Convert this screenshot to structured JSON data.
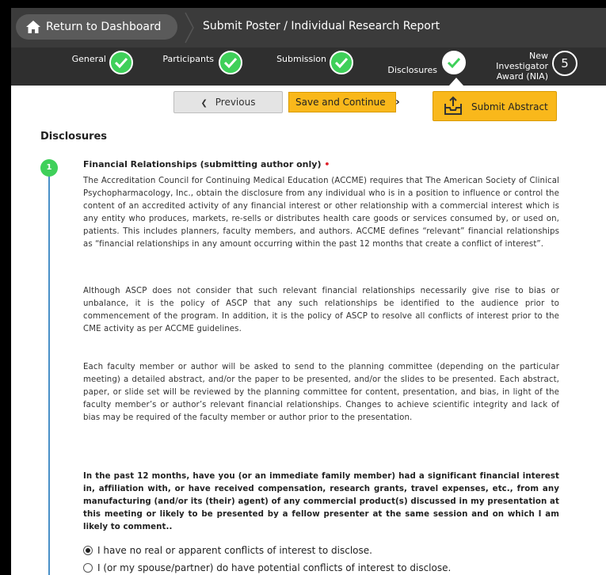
{
  "header": {
    "dashboard_label": "Return to Dashboard",
    "page_title": "Submit Poster / Individual Research Report"
  },
  "steps": {
    "general": "General",
    "participants": "Participants",
    "submission": "Submission",
    "disclosures": "Disclosures",
    "nia_line1": "New",
    "nia_line2": "Investigator",
    "nia_line3": "Award (NIA)",
    "nia_number": "5"
  },
  "actions": {
    "previous": "Previous",
    "save_continue": "Save and Continue",
    "submit": "Submit Abstract"
  },
  "section": {
    "title": "Disclosures",
    "step_number": "1",
    "question_title": "Financial Relationships (submitting author only)",
    "required_mark": "•",
    "para1": "The Accreditation Council for Continuing Medical Education (ACCME) requires that The American Society of Clinical Psychopharmacology, Inc., obtain the disclosure from any individual who is in a position to influence or control the content of an accredited activity of any financial interest or other relationship with a commercial interest which is any entity who produces, markets, re-sells or distributes health care goods or services consumed by, or used on, patients. This includes planners, faculty members, and authors. ACCME defines “relevant” financial relationships as “financial relationships in any amount occurring within the past 12 months that create a conflict of interest”.",
    "para2": "Although ASCP does not consider that such relevant financial relationships necessarily give rise to bias or unbalance, it is the policy of ASCP that any such relationships be identified to the audience prior to commencement of the program. In addition, it is the policy of ASCP to resolve all conflicts of interest prior to the CME activity as per ACCME guidelines.",
    "para3": "Each faculty member or author will be asked to send to the planning committee (depending on the particular meeting) a detailed abstract, and/or the paper to be presented, and/or the slides to be presented. Each abstract, paper, or slide set will be reviewed by the planning committee for content, presentation, and bias, in light of the faculty member’s or author’s relevant financial relationships. Changes to achieve scientific integrity and lack of bias may be required of the faculty member or author prior to the presentation.",
    "question": "In the past 12 months, have you (or an immediate family member) had a significant financial interest in, affiliation with, or have received compensation, research grants, travel expenses, etc., from any manufacturing (and/or its (their) agent) of any commercial product(s) discussed in my presentation at this meeting or likely to be presented by a fellow presenter at the same session and on which I am likely to comment..",
    "option1": "I have no real or apparent conflicts of interest to disclose.",
    "option2": "I (or my spouse/partner) do have potential conflicts of interest to disclose."
  },
  "colors": {
    "topbar": "#3b3b3b",
    "accent_green": "#3fd05a",
    "button_yellow": "#f9b81b",
    "timeline_blue": "#4a90c8"
  }
}
